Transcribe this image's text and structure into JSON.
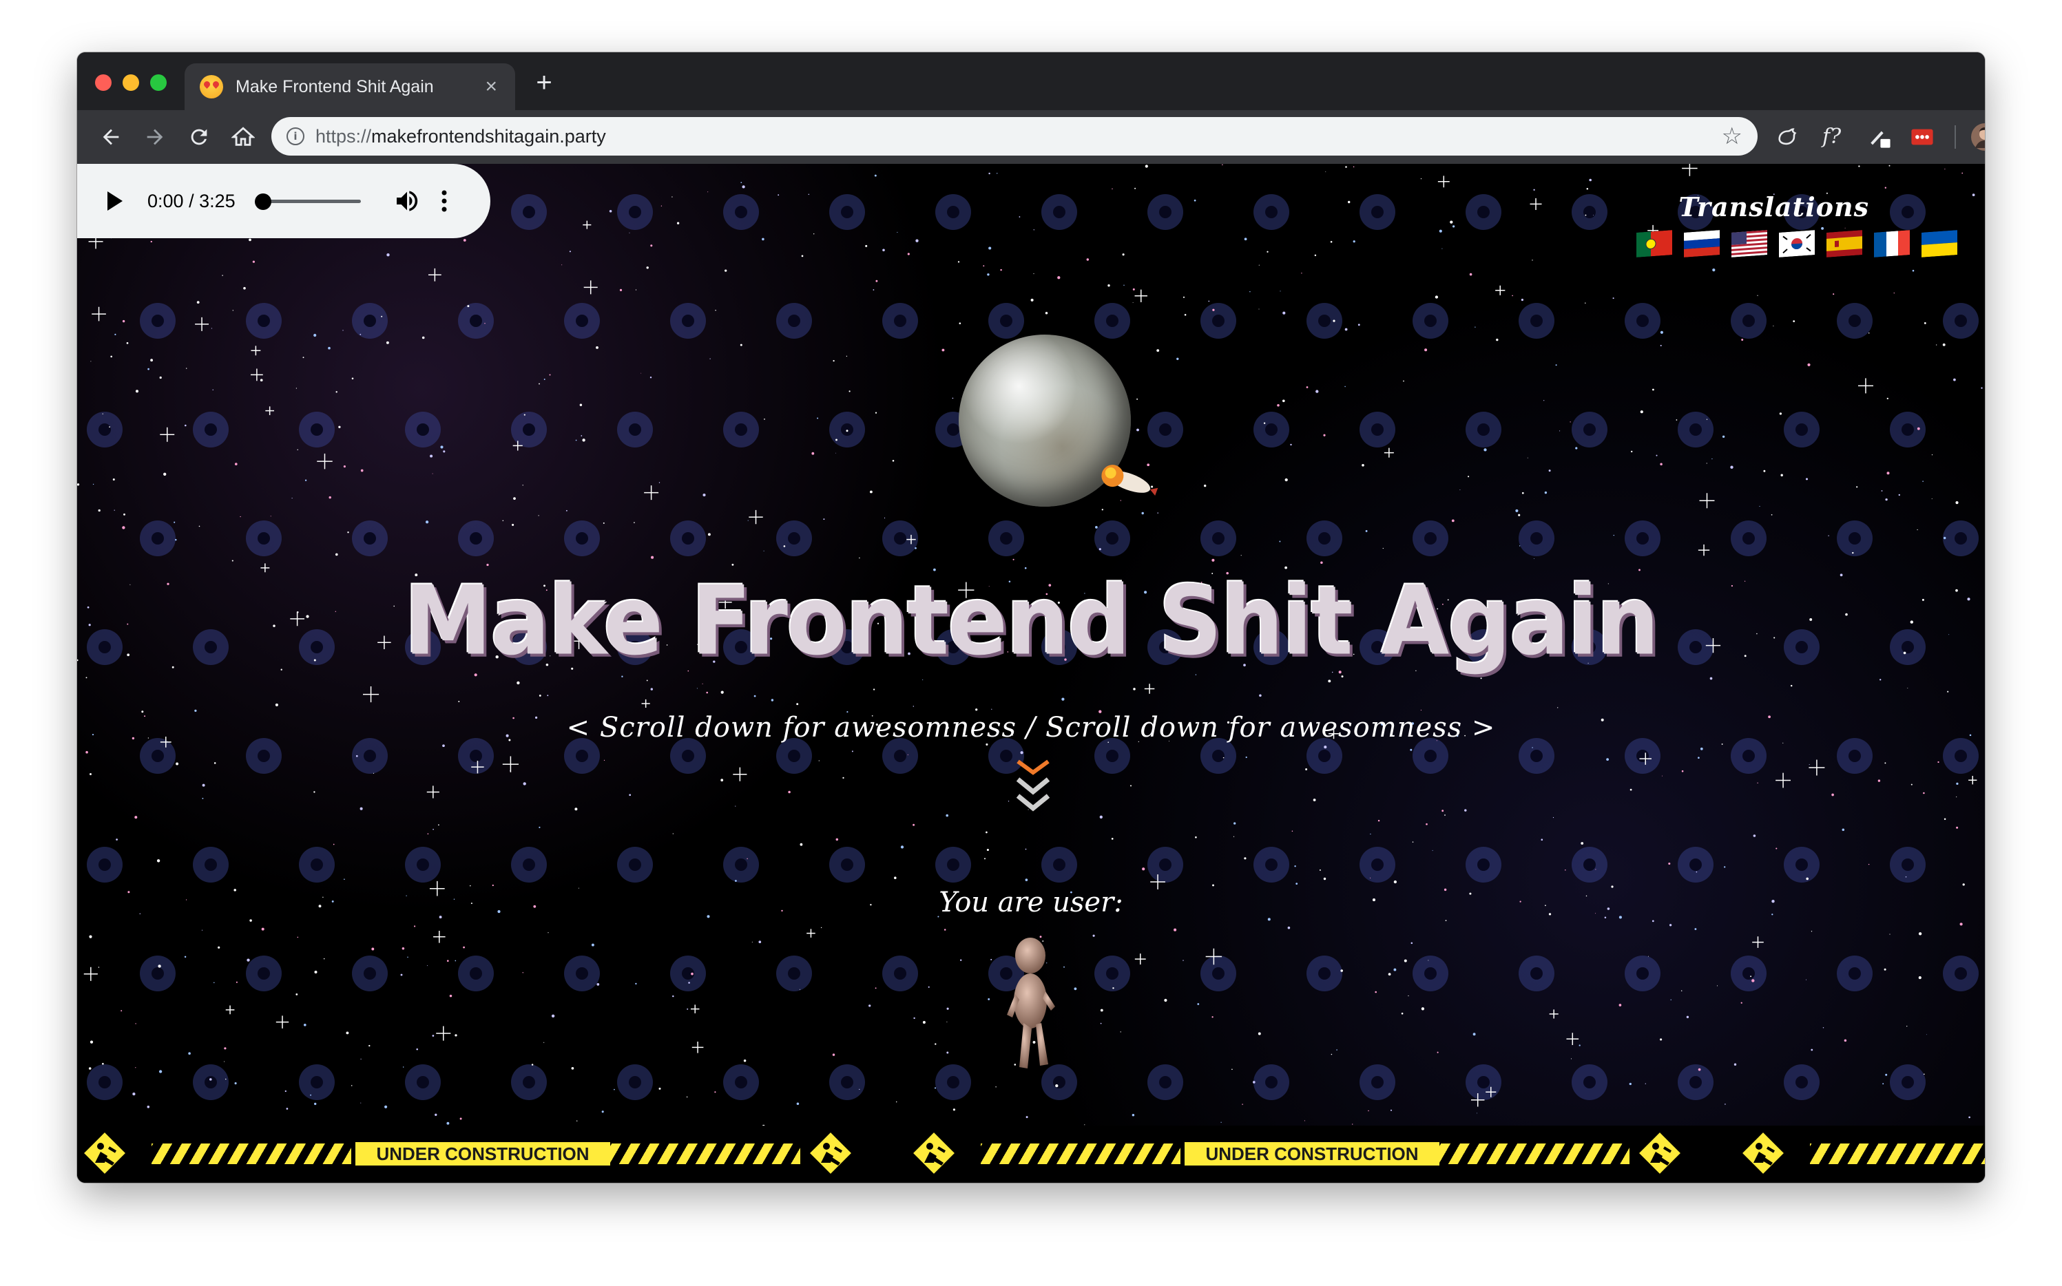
{
  "browser": {
    "tab_title": "Make Frontend Shit Again",
    "tab_close": "×",
    "new_tab": "+",
    "url_scheme": "https://",
    "url_host": "makefrontendshitagain.party",
    "star": "☆",
    "ext_fx": "f?"
  },
  "audio": {
    "current_time": "0:00",
    "separator": "/",
    "duration": "3:25",
    "progress_fraction": 0
  },
  "translations": {
    "label": "Translations",
    "flags": [
      "portugal",
      "russia",
      "usa",
      "south-korea",
      "spain",
      "france",
      "ukraine"
    ]
  },
  "hero": {
    "title": "Make Frontend Shit Again",
    "scroll_hint": "< Scroll down for awesomness / Scroll down for awesomness >"
  },
  "user": {
    "label": "You are user:"
  },
  "construction": {
    "banner_text": "UNDER CONSTRUCTION",
    "banner_text_cut": "UND"
  },
  "colors": {
    "tab_bar": "#202124",
    "toolbar": "#35363a",
    "omnibox": "#f1f3f4",
    "page_bg": "#000000",
    "title_fill": "#ddd3dc",
    "warning_yellow": "#ffeb3b",
    "chevron_accent": "#f07a2a"
  }
}
